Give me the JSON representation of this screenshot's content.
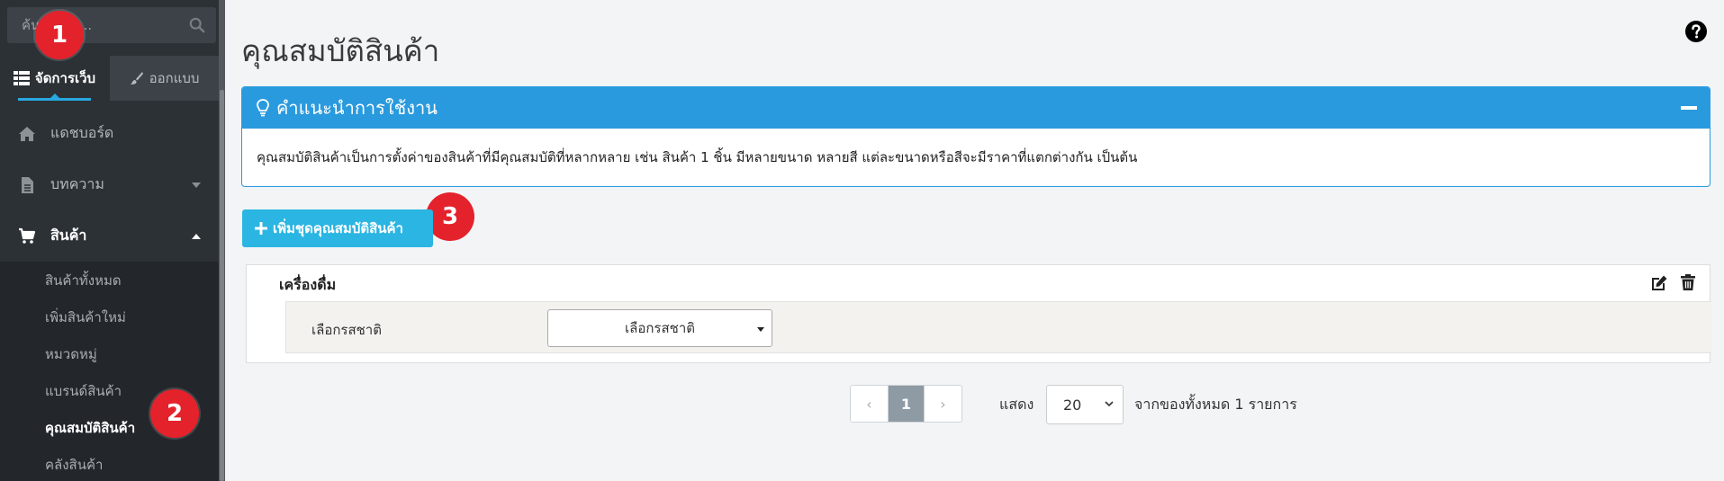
{
  "sidebar": {
    "search_placeholder": "ค้นหาเมนู...",
    "tabs": [
      {
        "label": "จัดการเว็บ",
        "icon": "table-icon",
        "active": true
      },
      {
        "label": "ออกแบบ",
        "icon": "brush-icon",
        "active": false
      }
    ],
    "menu": [
      {
        "label": "แดชบอร์ด",
        "icon": "home-icon"
      },
      {
        "label": "บทความ",
        "icon": "file-icon"
      },
      {
        "label": "สินค้า",
        "icon": "cart-icon"
      }
    ],
    "submenu": [
      "สินค้าทั้งหมด",
      "เพิ่มสินค้าใหม่",
      "หมวดหมู่",
      "แบรนด์สินค้า",
      "คุณสมบัติสินค้า",
      "คลังสินค้า"
    ]
  },
  "badges": [
    "1",
    "2",
    "3"
  ],
  "main": {
    "title": "คุณสมบัติสินค้า",
    "guide": {
      "title": "คำแนะนำการใช้งาน",
      "body": "คุณสมบัติสินค้าเป็นการตั้งค่าของสินค้าที่มีคุณสมบัติที่หลากหลาย เช่น สินค้า 1 ชิ้น มีหลายขนาด หลายสี แต่ละขนาดหรือสีจะมีราคาที่แตกต่างกัน เป็นต้น"
    },
    "add_button": "เพิ่มชุดคุณสมบัติสินค้า",
    "attribute_set": {
      "name": "เครื่องดื่ม",
      "rows": [
        {
          "label": "เลือกรสชาติ",
          "select_value": "เลือกรสชาติ"
        }
      ]
    },
    "pagination": {
      "prev": "‹",
      "current": "1",
      "next": "›",
      "show_label": "แสดง",
      "per_page": "20",
      "total_text": "จากของทั้งหมด 1 รายการ"
    }
  },
  "colors": {
    "sidebar_bg": "#2c3136",
    "accent": "#2a9ade",
    "button": "#2ab5e3",
    "badge": "#e4222c"
  }
}
